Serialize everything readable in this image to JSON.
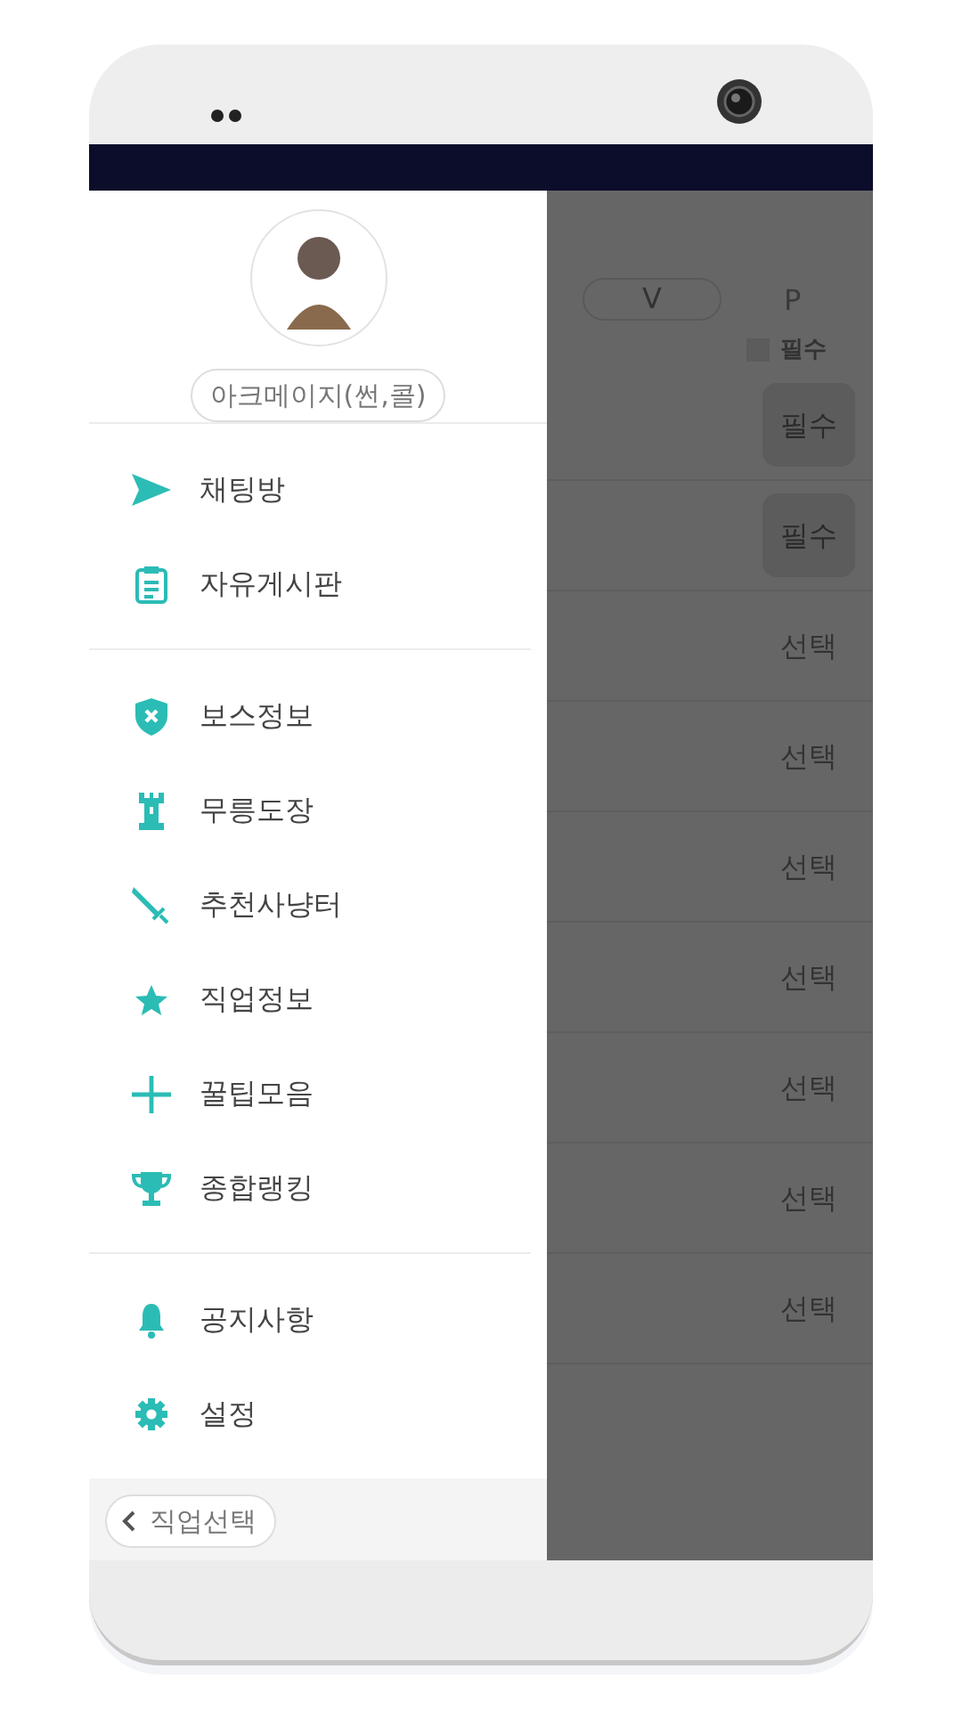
{
  "drawer": {
    "profile": {
      "job": "아크메이지(썬,콜)"
    },
    "groups": [
      [
        {
          "label": "채팅방"
        },
        {
          "label": "자유게시판"
        }
      ],
      [
        {
          "label": "보스정보"
        },
        {
          "label": "무릉도장"
        },
        {
          "label": "추천사냥터"
        },
        {
          "label": "직업정보"
        },
        {
          "label": "꿀팁모음"
        },
        {
          "label": "종합랭킹"
        }
      ],
      [
        {
          "label": "공지사항"
        },
        {
          "label": "설정"
        }
      ]
    ],
    "footer_button": {
      "label": "직업선택"
    }
  },
  "backdrop": {
    "header": {
      "pill": "V",
      "column": "P",
      "legend": "필수"
    },
    "rows": [
      {
        "kind": "required",
        "label": "필수"
      },
      {
        "kind": "required",
        "label": "필수"
      },
      {
        "kind": "optional",
        "label": "선택"
      },
      {
        "kind": "optional",
        "label": "선택"
      },
      {
        "kind": "optional",
        "label": "선택"
      },
      {
        "kind": "optional",
        "label": "선택"
      },
      {
        "kind": "optional",
        "label": "선택"
      },
      {
        "kind": "optional",
        "label": "선택"
      },
      {
        "kind": "optional",
        "label": "선택"
      }
    ]
  }
}
